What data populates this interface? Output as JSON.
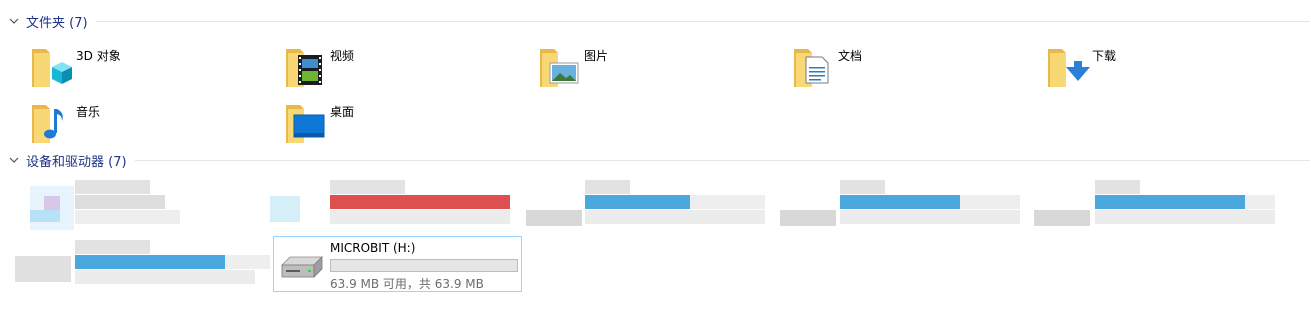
{
  "groups": {
    "folders": {
      "title": "文件夹 (7)"
    },
    "devices": {
      "title": "设备和驱动器 (7)"
    }
  },
  "folders": [
    {
      "label": "3D 对象",
      "icon": "3d-objects-folder-icon"
    },
    {
      "label": "视频",
      "icon": "videos-folder-icon"
    },
    {
      "label": "图片",
      "icon": "pictures-folder-icon"
    },
    {
      "label": "文档",
      "icon": "documents-folder-icon"
    },
    {
      "label": "下载",
      "icon": "downloads-folder-icon"
    },
    {
      "label": "音乐",
      "icon": "music-folder-icon"
    },
    {
      "label": "桌面",
      "icon": "desktop-folder-icon"
    }
  ],
  "drives": {
    "microbit": {
      "name": "MICROBIT (H:)",
      "space_text": "63.9 MB 可用，共 63.9 MB",
      "used_fraction": 0.0,
      "icon": "usb-drive-icon"
    }
  },
  "colors": {
    "header_text": "#1e3287",
    "folder_yellow": "#f8d775",
    "selection_border": "#99d1ff",
    "bar_blue": "#26a0da",
    "bar_red": "#da2626"
  }
}
